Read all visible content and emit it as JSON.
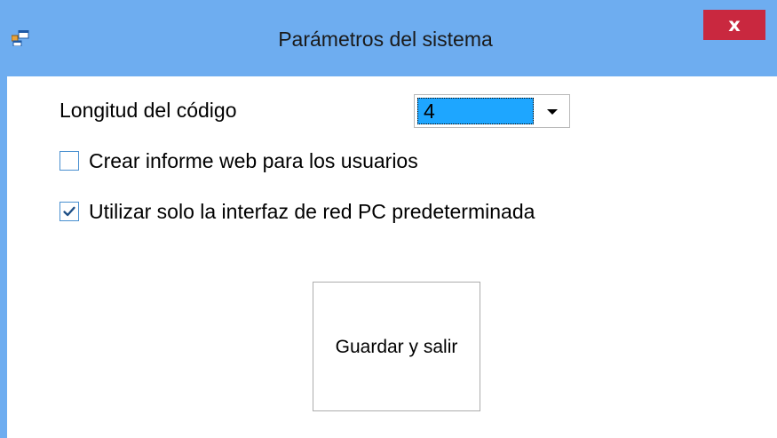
{
  "window": {
    "title": "Parámetros del sistema",
    "close_label": "x"
  },
  "form": {
    "code_length_label": "Longitud del código",
    "code_length_value": "4",
    "checkboxes": [
      {
        "label": "Crear informe web para los usuarios",
        "checked": false
      },
      {
        "label": "Utilizar solo la interfaz de red PC predeterminada",
        "checked": true
      }
    ],
    "save_button_label": "Guardar y salir"
  },
  "colors": {
    "titlebar": "#6eadf0",
    "close_button": "#c9283f",
    "selection": "#1ea6ff",
    "checkbox_border": "#4a90d0"
  },
  "icons": {
    "app": "app-window-icon",
    "close": "close-icon",
    "dropdown": "chevron-down-icon",
    "check": "checkmark-icon"
  }
}
